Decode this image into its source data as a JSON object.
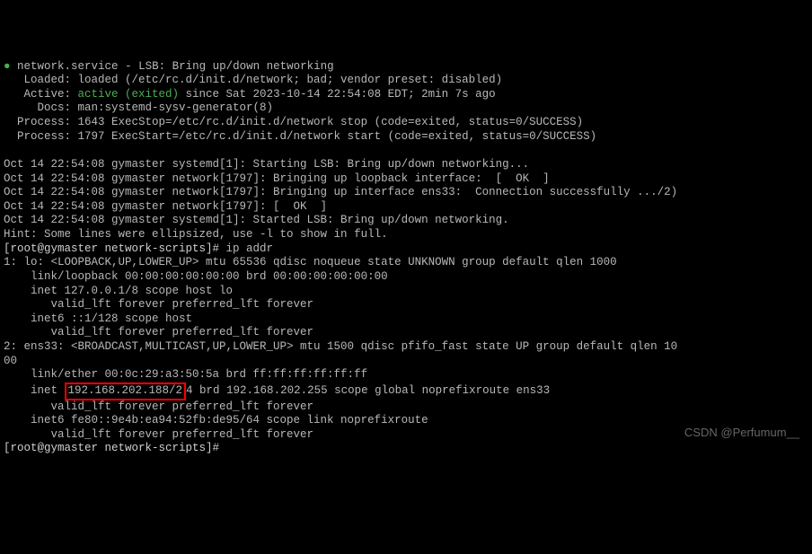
{
  "header_line": {
    "bullet": "●",
    "service_name": "network.service",
    "desc": " - LSB: Bring up/down networking"
  },
  "loaded_line": "   Loaded: loaded (/etc/rc.d/init.d/network; bad; vendor preset: disabled)",
  "active_line": {
    "prefix": "   Active: ",
    "status": "active (exited)",
    "suffix": " since Sat 2023-10-14 22:54:08 EDT; 2min 7s ago"
  },
  "docs_line": "     Docs: man:systemd-sysv-generator(8)",
  "process_lines": [
    "  Process: 1643 ExecStop=/etc/rc.d/init.d/network stop (code=exited, status=0/SUCCESS)",
    "  Process: 1797 ExecStart=/etc/rc.d/init.d/network start (code=exited, status=0/SUCCESS)"
  ],
  "log_lines": [
    "Oct 14 22:54:08 gymaster systemd[1]: Starting LSB: Bring up/down networking...",
    "Oct 14 22:54:08 gymaster network[1797]: Bringing up loopback interface:  [  OK  ]",
    "Oct 14 22:54:08 gymaster network[1797]: Bringing up interface ens33:  Connection successfully .../2)",
    "Oct 14 22:54:08 gymaster network[1797]: [  OK  ]",
    "Oct 14 22:54:08 gymaster systemd[1]: Started LSB: Bring up/down networking."
  ],
  "hint_line": "Hint: Some lines were ellipsized, use -l to show in full.",
  "prompt1": {
    "prefix": "[root@gymaster network-scripts]#",
    "cmd": " ip addr"
  },
  "ipaddr_lines": [
    "1: lo: <LOOPBACK,UP,LOWER_UP> mtu 65536 qdisc noqueue state UNKNOWN group default qlen 1000",
    "    link/loopback 00:00:00:00:00:00 brd 00:00:00:00:00:00",
    "    inet 127.0.0.1/8 scope host lo",
    "       valid_lft forever preferred_lft forever",
    "    inet6 ::1/128 scope host ",
    "       valid_lft forever preferred_lft forever",
    "2: ens33: <BROADCAST,MULTICAST,UP,LOWER_UP> mtu 1500 qdisc pfifo_fast state UP group default qlen 10",
    "00",
    "    link/ether 00:0c:29:a3:50:5a brd ff:ff:ff:ff:ff:ff"
  ],
  "highlighted_inet": {
    "prefix": "    inet ",
    "boxed": "192.168.202.188/2",
    "suffix": "4 brd 192.168.202.255 scope global noprefixroute ens33"
  },
  "ipaddr_lines2": [
    "       valid_lft forever preferred_lft forever",
    "    inet6 fe80::9e4b:ea94:52fb:de95/64 scope link noprefixroute ",
    "       valid_lft forever preferred_lft forever"
  ],
  "prompt2": "[root@gymaster network-scripts]#",
  "top_cut": "                                                                                 ",
  "watermark": "CSDN @Perfumum__"
}
